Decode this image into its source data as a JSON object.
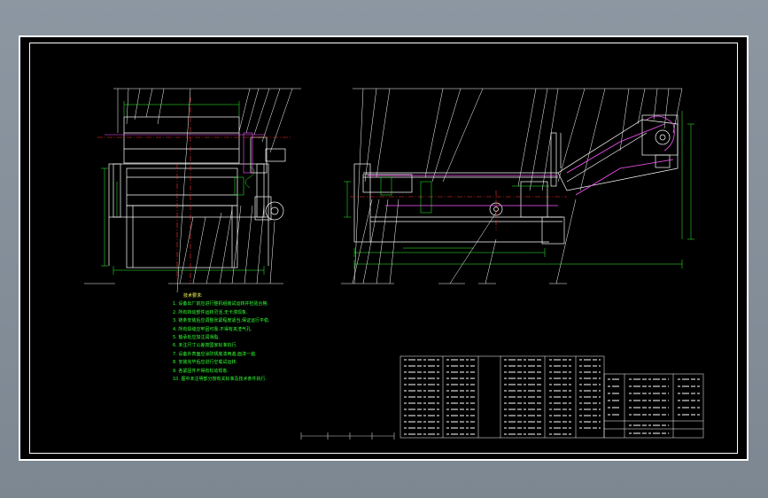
{
  "technical_requirements": {
    "title": "技术要求:",
    "items": [
      "1. 设备出厂前应进行整机组装试运转并检验合格.",
      "2. 所有转动部件运转灵活,无卡滞现象.",
      "3. 链条安装后应调整张紧程度适当,保证运行平稳.",
      "4. 所有焊缝应牢固可靠,不得有夹渣气孔.",
      "5. 轴承处应加注润滑脂.",
      "6. 未注尺寸公差按国家标准执行.",
      "7. 设备外表面应涂防锈底漆两遍,面漆一遍.",
      "8. 安装完毕后应进行空载试运转.",
      "9. 各紧固件不得有松动现象.",
      "10. 图中未注明部分按有关标准及技术条件执行."
    ]
  },
  "colors": {
    "background": "#000000",
    "frame": "#ffffff",
    "outline": "#ffffff",
    "dimension": "#33ff33",
    "centerline": "#ff3333",
    "hidden": "#ff55ff",
    "notes": "#33ff33"
  }
}
